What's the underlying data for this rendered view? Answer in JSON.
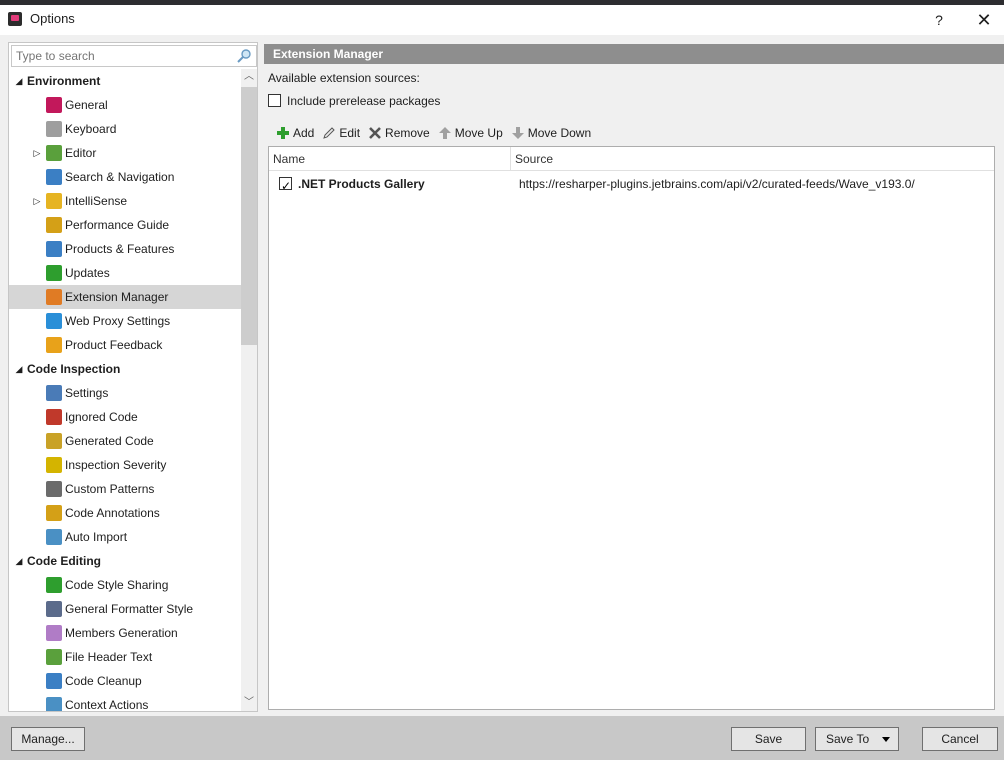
{
  "window": {
    "title": "Options",
    "help_label": "?",
    "close_label": "✕"
  },
  "search": {
    "placeholder": "Type to search"
  },
  "tree": [
    {
      "label": "Environment",
      "group": true,
      "expanded": true
    },
    {
      "label": "General",
      "icon": "resharper-icon"
    },
    {
      "label": "Keyboard",
      "icon": "keyboard-icon"
    },
    {
      "label": "Editor",
      "icon": "pencil-icon",
      "expandable": true
    },
    {
      "label": "Search & Navigation",
      "icon": "magnifier-icon"
    },
    {
      "label": "IntelliSense",
      "icon": "lightbulb-icon",
      "expandable": true
    },
    {
      "label": "Performance Guide",
      "icon": "performance-icon"
    },
    {
      "label": "Products & Features",
      "icon": "blocks-icon"
    },
    {
      "label": "Updates",
      "icon": "download-icon"
    },
    {
      "label": "Extension Manager",
      "icon": "extension-icon",
      "selected": true
    },
    {
      "label": "Web Proxy Settings",
      "icon": "globe-icon"
    },
    {
      "label": "Product Feedback",
      "icon": "envelope-icon"
    },
    {
      "label": "Code Inspection",
      "group": true,
      "expanded": true
    },
    {
      "label": "Settings",
      "icon": "settings-icon"
    },
    {
      "label": "Ignored Code",
      "icon": "ignored-icon"
    },
    {
      "label": "Generated Code",
      "icon": "generated-icon"
    },
    {
      "label": "Inspection Severity",
      "icon": "severity-icon"
    },
    {
      "label": "Custom Patterns",
      "icon": "patterns-icon"
    },
    {
      "label": "Code Annotations",
      "icon": "annotations-icon"
    },
    {
      "label": "Auto Import",
      "icon": "funnel-icon"
    },
    {
      "label": "Code Editing",
      "group": true,
      "expanded": true
    },
    {
      "label": "Code Style Sharing",
      "icon": "sharing-icon"
    },
    {
      "label": "General Formatter Style",
      "icon": "formatter-icon"
    },
    {
      "label": "Members Generation",
      "icon": "members-icon"
    },
    {
      "label": "File Header Text",
      "icon": "header-icon"
    },
    {
      "label": "Code Cleanup",
      "icon": "broom-icon"
    },
    {
      "label": "Context Actions",
      "icon": "context-icon"
    }
  ],
  "panel": {
    "title": "Extension Manager",
    "sources_label": "Available extension sources:",
    "prerelease_label": "Include prerelease packages",
    "prerelease_checked": false
  },
  "toolbar": {
    "add": "Add",
    "edit": "Edit",
    "remove": "Remove",
    "move_up": "Move Up",
    "move_down": "Move Down"
  },
  "table": {
    "columns": [
      "Name",
      "Source"
    ],
    "rows": [
      {
        "checked": true,
        "name": ".NET Products Gallery",
        "source": "https://resharper-plugins.jetbrains.com/api/v2/curated-feeds/Wave_v193.0/"
      }
    ]
  },
  "buttons": {
    "manage": "Manage...",
    "save": "Save",
    "save_to": "Save To",
    "cancel": "Cancel"
  },
  "colors": {
    "header_bg": "#8e8e8e",
    "selection_bg": "#d6d6d6",
    "bottom_bar_bg": "#c8c8c8",
    "add_icon": "#2e9e2e"
  }
}
